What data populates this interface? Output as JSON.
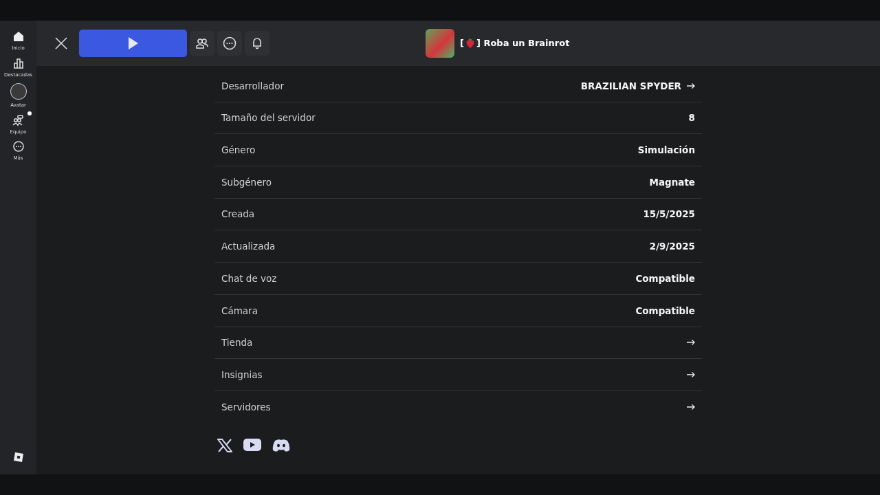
{
  "sidebar": {
    "items": [
      {
        "label": "Inicio",
        "notification": false
      },
      {
        "label": "Destacadas",
        "notification": false
      },
      {
        "label": "Avatar",
        "notification": false
      },
      {
        "label": "Equipo",
        "notification": true
      },
      {
        "label": "Más",
        "notification": false
      }
    ]
  },
  "header": {
    "game_title_prefix": "[",
    "game_title": "] Roba un Brainrot"
  },
  "details": [
    {
      "label": "Desarrollador",
      "value": "BRAZILIAN SPYDER",
      "arrow": true
    },
    {
      "label": "Tamaño del servidor",
      "value": "8",
      "arrow": false
    },
    {
      "label": "Género",
      "value": "Simulación",
      "arrow": false
    },
    {
      "label": "Subgénero",
      "value": "Magnate",
      "arrow": false
    },
    {
      "label": "Creada",
      "value": "15/5/2025",
      "arrow": false
    },
    {
      "label": "Actualizada",
      "value": "2/9/2025",
      "arrow": false
    },
    {
      "label": "Chat de voz",
      "value": "Compatible",
      "arrow": false
    },
    {
      "label": "Cámara",
      "value": "Compatible",
      "arrow": false
    },
    {
      "label": "Tienda",
      "arrow": true
    },
    {
      "label": "Insignias",
      "arrow": true
    },
    {
      "label": "Servidores",
      "arrow": true
    }
  ],
  "social": [
    {
      "kind": "x"
    },
    {
      "kind": "youtube"
    },
    {
      "kind": "discord"
    }
  ]
}
